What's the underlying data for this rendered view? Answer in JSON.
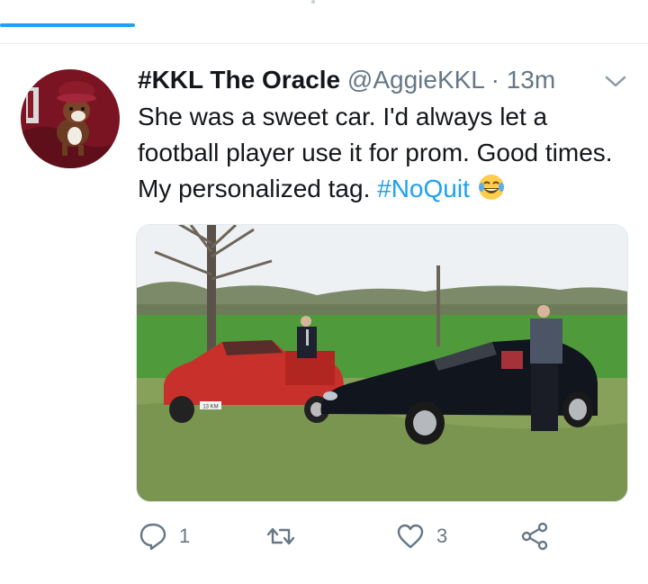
{
  "tweet": {
    "display_name": "#KKL The Oracle",
    "handle": "@AggieKKL",
    "separator": "·",
    "time": "13m",
    "text_main": "She was a sweet car. I'd always let a football player use it for prom. Good times. My personalized tag. ",
    "hashtag": "#NoQuit",
    "emoji": "face-with-tears-of-joy-emoji",
    "plate_text": "13 KM"
  },
  "actions": {
    "reply_count": "1",
    "retweet_count": "",
    "like_count": "3"
  },
  "icons": {
    "reply": "reply-icon",
    "retweet": "retweet-icon",
    "like": "heart-icon",
    "share": "share-icon",
    "menu": "chevron-down-icon"
  },
  "colors": {
    "link": "#1da1f2",
    "text": "#14171a",
    "secondary": "#657786",
    "divider": "#e6ecf0"
  }
}
